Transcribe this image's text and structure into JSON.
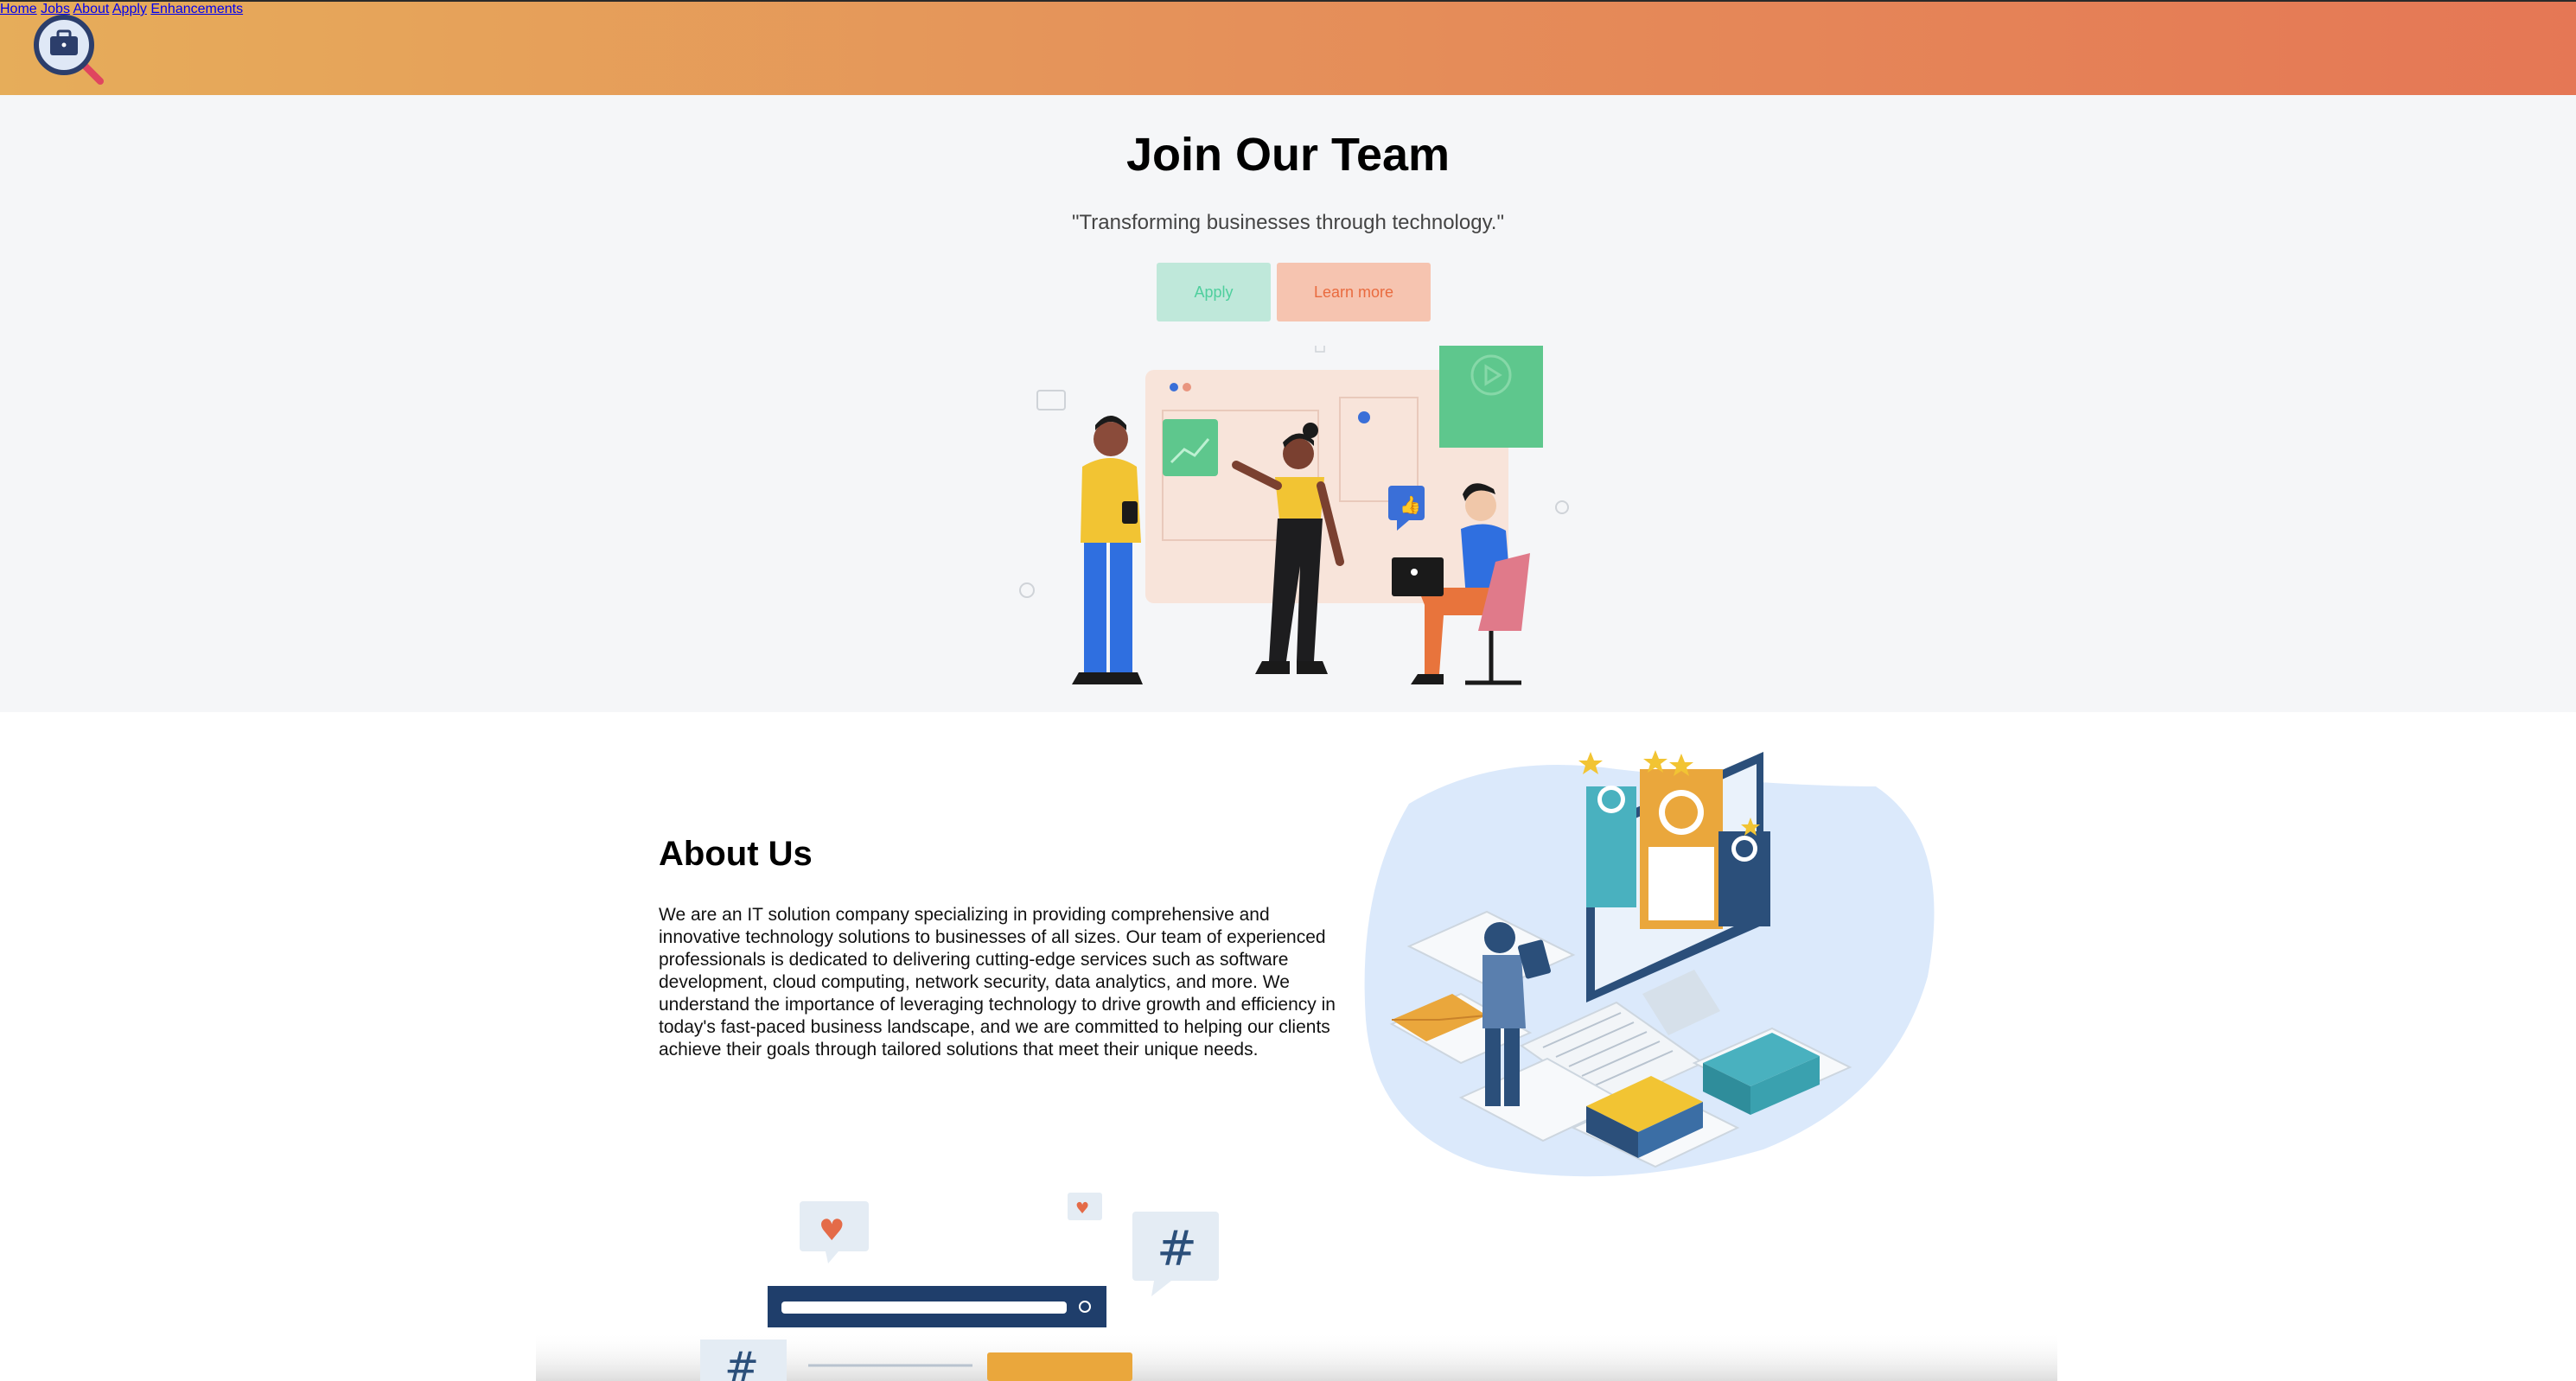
{
  "header": {
    "logo_icon": "briefcase-magnifier-icon",
    "nav": [
      "Home",
      "Jobs",
      "About",
      "Apply",
      "Enhancements"
    ]
  },
  "hero": {
    "title": "Join Our Team",
    "tagline": "\"Transforming businesses through technology.\"",
    "apply_label": "Apply",
    "learn_label": "Learn more"
  },
  "about": {
    "title": "About Us",
    "text": "We are an IT solution company specializing in providing comprehensive and innovative technology solutions to businesses of all sizes. Our team of experienced professionals is dedicated to delivering cutting-edge services such as software development, cloud computing, network security, data analytics, and more. We understand the importance of leveraging technology to drive growth and efficiency in today's fast-paced business landscape, and we are committed to helping our clients achieve their goals through tailored solutions that meet their unique needs."
  },
  "colors": {
    "header_start": "#e6ad5a",
    "header_end": "#e57755",
    "apply_bg": "#bfe8da",
    "learn_bg": "#f6c4b0"
  }
}
